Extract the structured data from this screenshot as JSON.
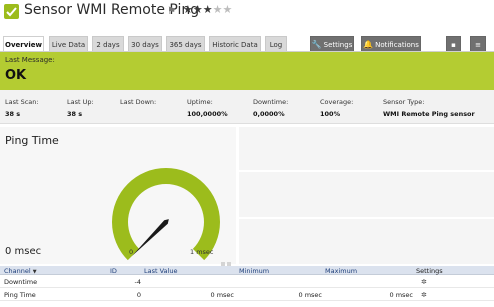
{
  "header": {
    "title": "Sensor WMI Remote Ping",
    "status_icon": "green-check-icon",
    "flag_icon": "flag-icon",
    "priority_stars": 3,
    "priority_max": 5
  },
  "tabs": [
    {
      "label": "Overview",
      "active": true
    },
    {
      "label": "Live Data"
    },
    {
      "label": "2 days"
    },
    {
      "label": "30 days"
    },
    {
      "label": "365 days"
    },
    {
      "label": "Historic Data"
    },
    {
      "label": "Log"
    }
  ],
  "tool_tabs": {
    "settings": "Settings",
    "notifications": "Notifications"
  },
  "status": {
    "label": "Last Message:",
    "value": "OK",
    "color": "#b4cc32"
  },
  "info": [
    {
      "label": "Last Scan:",
      "value": "38 s"
    },
    {
      "label": "Last Up:",
      "value": "38 s"
    },
    {
      "label": "Last Down:",
      "value": ""
    },
    {
      "label": "Uptime:",
      "value": "100,0000%"
    },
    {
      "label": "Downtime:",
      "value": "0,0000%"
    },
    {
      "label": "Coverage:",
      "value": "100%"
    },
    {
      "label": "Sensor Type:",
      "value": "WMI Remote Ping sensor"
    }
  ],
  "gauge": {
    "title": "Ping Time",
    "value_text": "0 msec",
    "min_label": "0",
    "max_label": "1 msec",
    "value_fraction": 0.0,
    "color": "#9cbc1c"
  },
  "table": {
    "headers": {
      "channel": "Channel",
      "id": "ID",
      "last_value": "Last Value",
      "minimum": "Minimum",
      "maximum": "Maximum",
      "settings": "Settings"
    },
    "rows": [
      {
        "channel": "Downtime",
        "id": "-4",
        "last_value": "",
        "minimum": "",
        "maximum": ""
      },
      {
        "channel": "Ping Time",
        "id": "0",
        "last_value": "0 msec",
        "minimum": "0 msec",
        "maximum": "0 msec"
      }
    ]
  }
}
